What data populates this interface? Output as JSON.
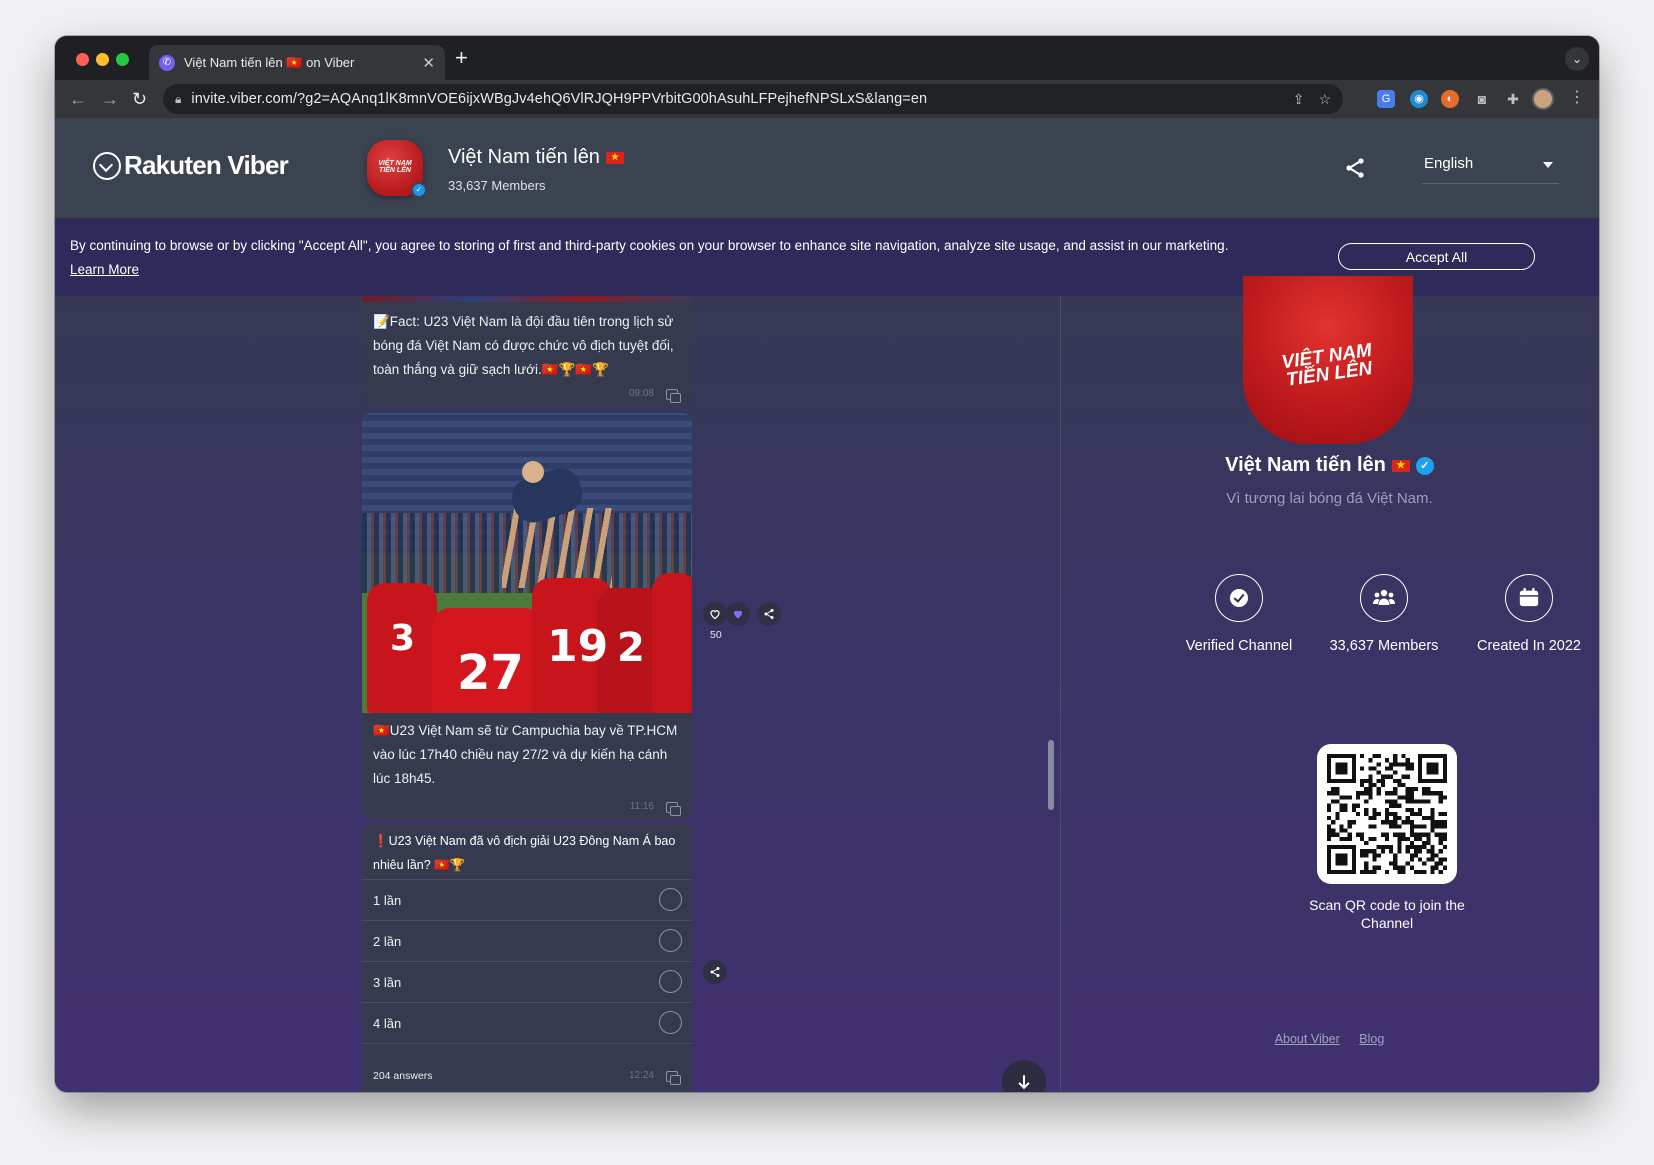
{
  "browser": {
    "tab_title": "Việt Nam tiến lên 🇻🇳 on Viber",
    "url": "invite.viber.com/?g2=AQAnq1lK8mnVOE6ijxWBgJv4ehQ6VlRJQH9PPVrbitG00hAsuhLFPejhefNPSLxS&lang=en"
  },
  "header": {
    "brand": "Rakuten Viber",
    "channel_name": "Việt Nam tiến lên",
    "members": "33,637 Members",
    "language": "English"
  },
  "cookie": {
    "text": "By continuing to browse or by clicking \"Accept All\", you agree to storing of first and third-party cookies on your browser to enhance site navigation, analyze site usage, and assist in our marketing.",
    "learn_more": "Learn More",
    "accept": "Accept All"
  },
  "feed": {
    "msg1": {
      "text": "📝Fact: U23 Việt Nam là đội đầu tiên trong lịch sử bóng đá Việt Nam có được chức vô địch tuyệt đối, toàn thắng và giữ sạch lưới.🇻🇳🏆🇻🇳🏆",
      "time": "09:08"
    },
    "msg2": {
      "text": "🇻🇳U23 Việt Nam sẽ từ Campuchia bay về TP.HCM vào lúc 17h40 chiều nay 27/2 và dự kiến hạ cánh lúc 18h45.",
      "time": "11:16",
      "reactions": "50",
      "photo_numbers": {
        "a": "3",
        "b": "27",
        "c": "19",
        "d": "2"
      }
    },
    "poll": {
      "question": "❗U23 Việt Nam đã vô địch giải U23 Đông Nam Á bao nhiêu lần? 🇻🇳🏆",
      "options": [
        "1 lần",
        "2 lần",
        "3 lần",
        "4 lần"
      ],
      "answers": "204 answers",
      "time": "12:24"
    }
  },
  "profile": {
    "avatar_text_1": "VIỆT NAM",
    "avatar_text_2": "TIẾN LÊN",
    "name": "Việt Nam tiến lên",
    "description": "Vì tương lai bóng đá Việt Nam.",
    "stats": [
      "Verified Channel",
      "33,637 Members",
      "Created In 2022"
    ],
    "qr_label": "Scan QR code to join the Channel",
    "footer_links": [
      "About Viber",
      "Blog"
    ]
  },
  "colors": {
    "viber_purple": "#7360f2",
    "verified_blue": "#1da1f2",
    "flag_red": "#da251d",
    "flag_star": "#ffdd00"
  }
}
